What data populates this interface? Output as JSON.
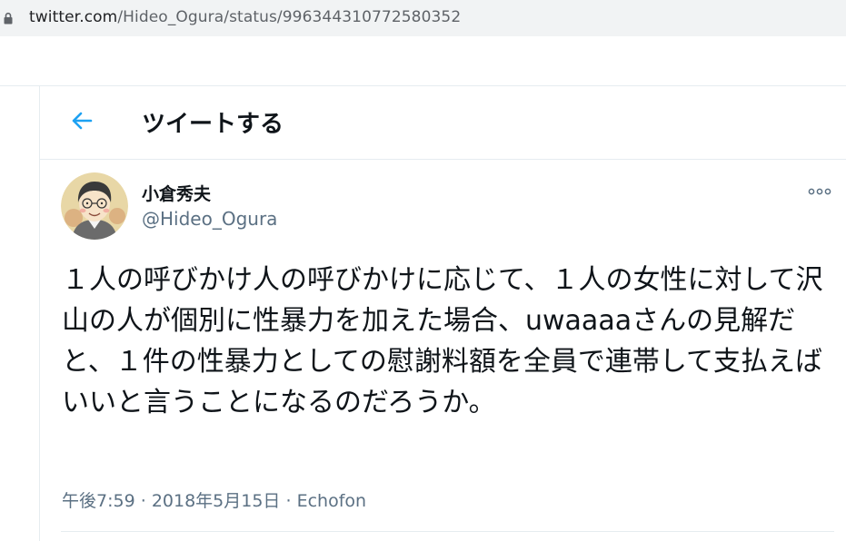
{
  "browser": {
    "url_host": "twitter.com",
    "url_path": "/Hideo_Ogura/status/996344310772580352"
  },
  "header": {
    "title": "ツイートする"
  },
  "tweet": {
    "author_name": "小倉秀夫",
    "author_handle": "@Hideo_Ogura",
    "text": "１人の呼びかけ人の呼びかけに応じて、１人の女性に対して沢山の人が個別に性暴力を加えた場合、uwaaaaさんの見解だと、１件の性暴力としての慰謝料額を全員で連帯して支払えばいいと言うことになるのだろうか。",
    "time": "午後7:59",
    "separator": "·",
    "date": "2018年5月15日",
    "source": "Echofon"
  },
  "colors": {
    "accent": "#1da1f2",
    "secondary_text": "#5b7083",
    "primary_text": "#0f1419",
    "border": "#e6ecf0"
  },
  "icons": {
    "back": "arrow-left-icon",
    "more": "more-horizontal-icon",
    "lock": "lock-icon"
  }
}
